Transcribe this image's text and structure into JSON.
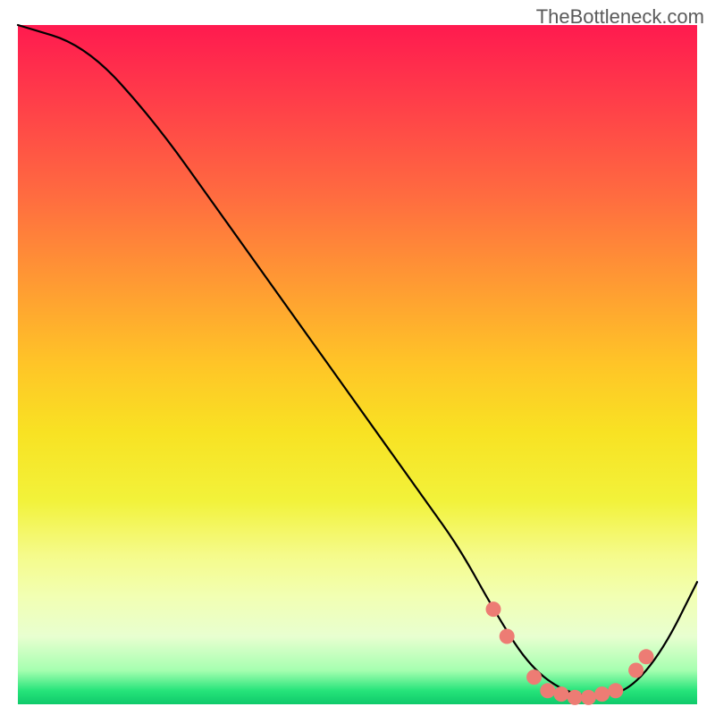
{
  "watermark": "TheBottleneck.com",
  "chart_data": {
    "type": "line",
    "title": "",
    "xlabel": "",
    "ylabel": "",
    "xlim": [
      0,
      100
    ],
    "ylim": [
      0,
      100
    ],
    "curve": {
      "x": [
        0,
        10,
        20,
        30,
        40,
        50,
        60,
        65,
        70,
        75,
        80,
        85,
        90,
        95,
        100
      ],
      "y": [
        100,
        97,
        86,
        72,
        58,
        44,
        30,
        23,
        14,
        6,
        2,
        1,
        2,
        8,
        18
      ]
    },
    "markers": {
      "color": "#ed7c74",
      "points": [
        {
          "x": 70,
          "y": 14
        },
        {
          "x": 72,
          "y": 10
        },
        {
          "x": 76,
          "y": 4
        },
        {
          "x": 78,
          "y": 2
        },
        {
          "x": 80,
          "y": 1.5
        },
        {
          "x": 82,
          "y": 1
        },
        {
          "x": 84,
          "y": 1
        },
        {
          "x": 86,
          "y": 1.5
        },
        {
          "x": 88,
          "y": 2
        },
        {
          "x": 91,
          "y": 5
        },
        {
          "x": 92.5,
          "y": 7
        }
      ]
    },
    "gradient_stops": [
      {
        "pos": 0,
        "color": "#ff1a4f"
      },
      {
        "pos": 25,
        "color": "#ff6b40"
      },
      {
        "pos": 50,
        "color": "#ffc527"
      },
      {
        "pos": 70,
        "color": "#f2f23a"
      },
      {
        "pos": 90,
        "color": "#e8ffd0"
      },
      {
        "pos": 100,
        "color": "#0fc96b"
      }
    ]
  }
}
